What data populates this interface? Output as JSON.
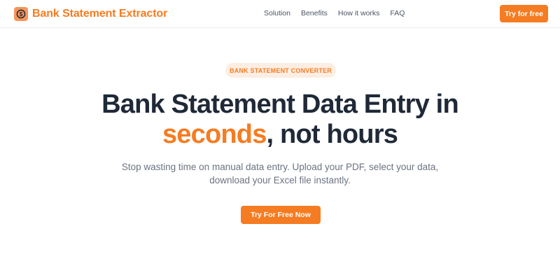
{
  "brand": {
    "name": "Bank Statement Extractor",
    "icon": "dollar-coin-icon",
    "icon_color": "#f7955a"
  },
  "nav": {
    "links": [
      "Solution",
      "Benefits",
      "How it works",
      "FAQ"
    ],
    "cta_label": "Try for free"
  },
  "hero": {
    "badge": "BANK STATEMENT CONVERTER",
    "headline_line1": "Bank Statement Data Entry in",
    "headline_accent": "seconds",
    "headline_rest": ", not hours",
    "subtext": "Stop wasting time on manual data entry. Upload your PDF, select your data, download your Excel file instantly.",
    "cta_label": "Try For Free Now"
  },
  "colors": {
    "accent": "#f57c22",
    "heading": "#1f2937",
    "body_text": "#6b7280",
    "badge_bg": "#fdeee3"
  }
}
